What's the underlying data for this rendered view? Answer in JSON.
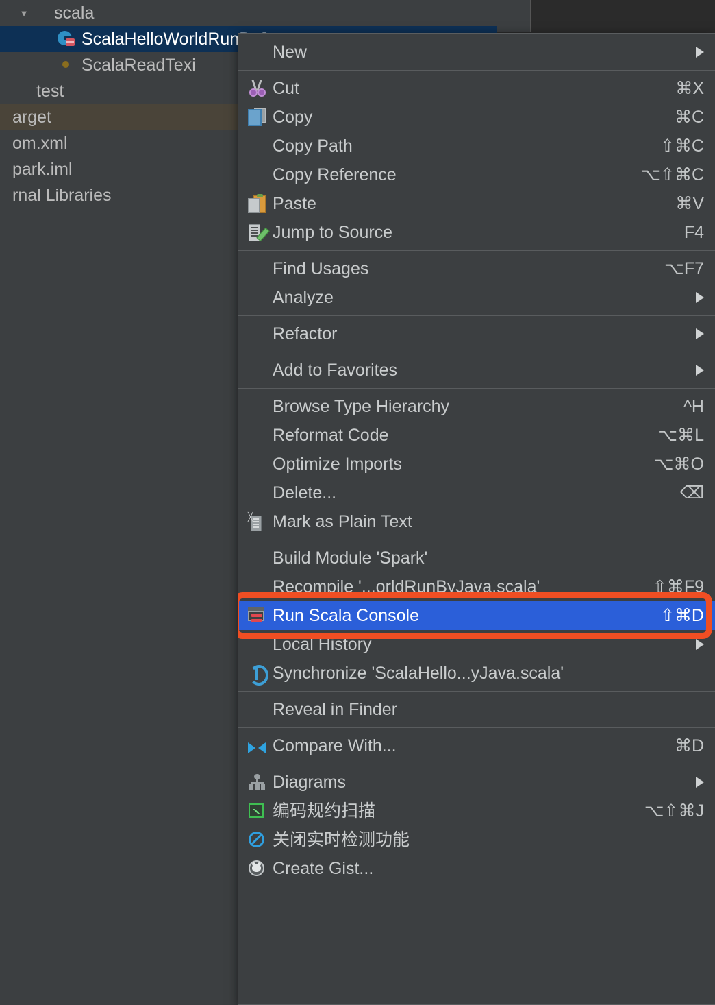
{
  "project_tree": {
    "rows": [
      {
        "label": "scala",
        "icon": "folder-blue-icon",
        "indent": 26,
        "arrow": "▼",
        "state": "normal"
      },
      {
        "label": "ScalaHelloWorldRunByJava",
        "icon": "scala-class-icon",
        "indent": 66,
        "arrow": "",
        "state": "selected"
      },
      {
        "label": "ScalaReadTexi",
        "icon": "scala-object-icon",
        "indent": 66,
        "arrow": "",
        "state": "normal"
      },
      {
        "label": "test",
        "icon": "folder-gray-icon",
        "indent": 0,
        "arrow": "",
        "state": "normal"
      },
      {
        "label": "arget",
        "icon": "none",
        "indent": 0,
        "arrow": "",
        "state": "hovered"
      },
      {
        "label": "om.xml",
        "icon": "none",
        "indent": 0,
        "arrow": "",
        "state": "normal"
      },
      {
        "label": "park.iml",
        "icon": "none",
        "indent": 0,
        "arrow": "",
        "state": "normal"
      },
      {
        "label": "rnal Libraries",
        "icon": "none",
        "indent": 0,
        "arrow": "",
        "state": "normal"
      }
    ]
  },
  "context_menu": {
    "highlight_color": "#f04e23",
    "selection_color": "#2b5fd9",
    "groups": [
      {
        "items": [
          {
            "label": "New",
            "shortcut": "",
            "icon": "none",
            "submenu": true,
            "selected": false
          }
        ]
      },
      {
        "items": [
          {
            "label": "Cut",
            "shortcut": "⌘X",
            "icon": "cut-icon",
            "submenu": false,
            "selected": false
          },
          {
            "label": "Copy",
            "shortcut": "⌘C",
            "icon": "copy-icon",
            "submenu": false,
            "selected": false
          },
          {
            "label": "Copy Path",
            "shortcut": "⇧⌘C",
            "icon": "none",
            "submenu": false,
            "selected": false
          },
          {
            "label": "Copy Reference",
            "shortcut": "⌥⇧⌘C",
            "icon": "none",
            "submenu": false,
            "selected": false
          },
          {
            "label": "Paste",
            "shortcut": "⌘V",
            "icon": "paste-icon",
            "submenu": false,
            "selected": false
          },
          {
            "label": "Jump to Source",
            "shortcut": "F4",
            "icon": "jump-to-source-icon",
            "submenu": false,
            "selected": false
          }
        ]
      },
      {
        "items": [
          {
            "label": "Find Usages",
            "shortcut": "⌥F7",
            "icon": "none",
            "submenu": false,
            "selected": false
          },
          {
            "label": "Analyze",
            "shortcut": "",
            "icon": "none",
            "submenu": true,
            "selected": false
          }
        ]
      },
      {
        "items": [
          {
            "label": "Refactor",
            "shortcut": "",
            "icon": "none",
            "submenu": true,
            "selected": false
          }
        ]
      },
      {
        "items": [
          {
            "label": "Add to Favorites",
            "shortcut": "",
            "icon": "none",
            "submenu": true,
            "selected": false
          }
        ]
      },
      {
        "items": [
          {
            "label": "Browse Type Hierarchy",
            "shortcut": "^H",
            "icon": "none",
            "submenu": false,
            "selected": false
          },
          {
            "label": "Reformat Code",
            "shortcut": "⌥⌘L",
            "icon": "none",
            "submenu": false,
            "selected": false
          },
          {
            "label": "Optimize Imports",
            "shortcut": "⌥⌘O",
            "icon": "none",
            "submenu": false,
            "selected": false
          },
          {
            "label": "Delete...",
            "shortcut": "⌫",
            "icon": "none",
            "submenu": false,
            "selected": false
          },
          {
            "label": "Mark as Plain Text",
            "shortcut": "",
            "icon": "plain-text-icon",
            "submenu": false,
            "selected": false
          }
        ]
      },
      {
        "items": [
          {
            "label": "Build Module 'Spark'",
            "shortcut": "",
            "icon": "none",
            "submenu": false,
            "selected": false
          },
          {
            "label": "Recompile '...orldRunByJava.scala'",
            "shortcut": "⇧⌘F9",
            "icon": "none",
            "submenu": false,
            "selected": false
          },
          {
            "label": "Run Scala Console",
            "shortcut": "⇧⌘D",
            "icon": "scala-console-icon",
            "submenu": false,
            "selected": true
          },
          {
            "label": "Local History",
            "shortcut": "",
            "icon": "none",
            "submenu": true,
            "selected": false
          },
          {
            "label": "Synchronize 'ScalaHello...yJava.scala'",
            "shortcut": "",
            "icon": "sync-icon",
            "submenu": false,
            "selected": false
          }
        ]
      },
      {
        "items": [
          {
            "label": "Reveal in Finder",
            "shortcut": "",
            "icon": "none",
            "submenu": false,
            "selected": false
          }
        ]
      },
      {
        "items": [
          {
            "label": "Compare With...",
            "shortcut": "⌘D",
            "icon": "compare-icon",
            "submenu": false,
            "selected": false
          }
        ]
      },
      {
        "items": [
          {
            "label": "Diagrams",
            "shortcut": "",
            "icon": "diagrams-icon",
            "submenu": true,
            "selected": false
          },
          {
            "label": "编码规约扫描",
            "shortcut": "⌥⇧⌘J",
            "icon": "code-scan-icon",
            "submenu": false,
            "selected": false
          },
          {
            "label": "关闭实时检测功能",
            "shortcut": "",
            "icon": "disable-icon",
            "submenu": false,
            "selected": false
          },
          {
            "label": "Create Gist...",
            "shortcut": "",
            "icon": "gist-icon",
            "submenu": false,
            "selected": false
          }
        ]
      }
    ]
  }
}
